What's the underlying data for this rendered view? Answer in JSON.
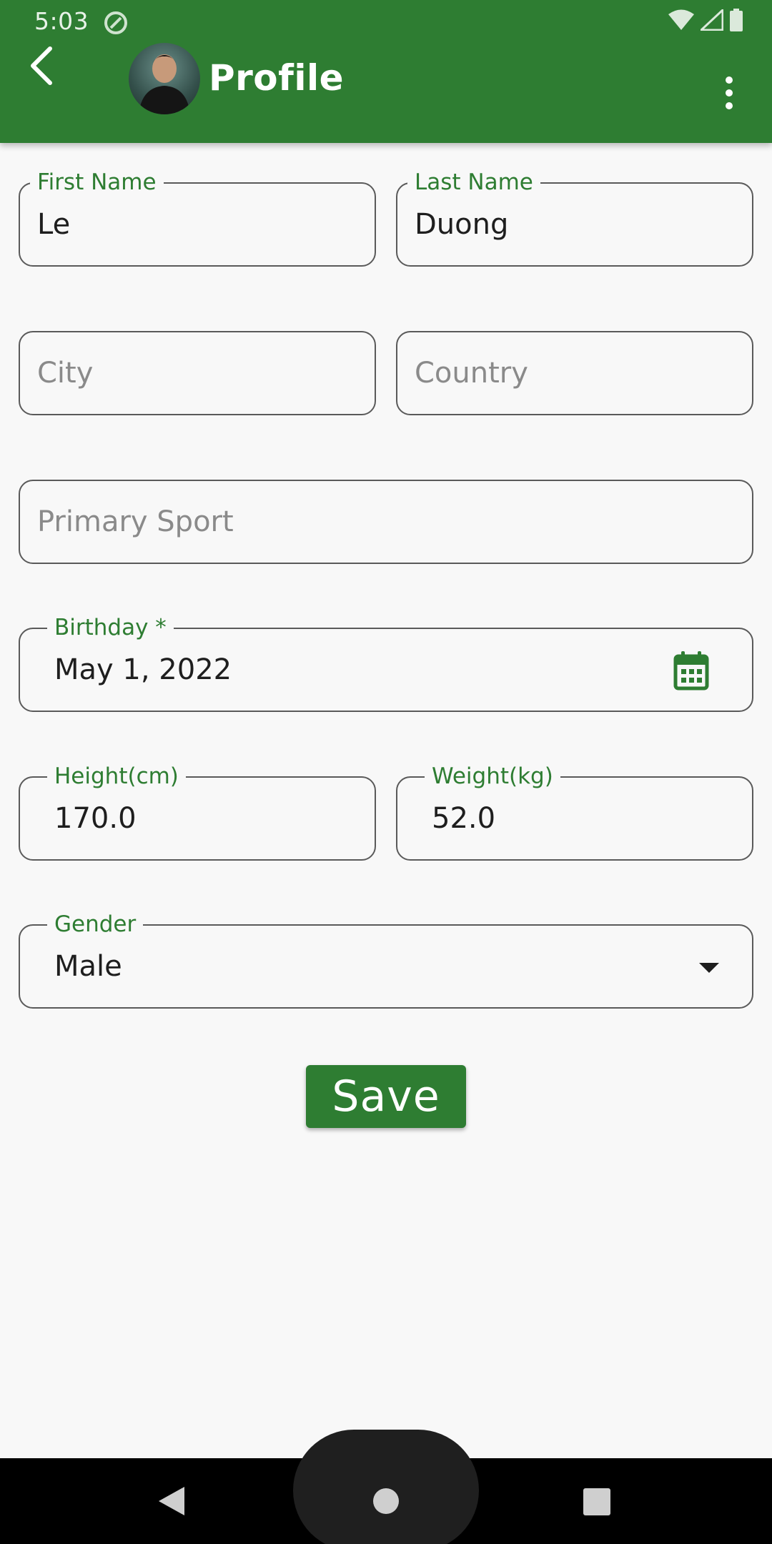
{
  "status_bar": {
    "time": "5:03"
  },
  "app_bar": {
    "title": "Profile"
  },
  "form": {
    "first_name": {
      "label": "First Name",
      "value": "Le"
    },
    "last_name": {
      "label": "Last Name",
      "value": "Duong"
    },
    "city": {
      "placeholder": "City"
    },
    "country": {
      "placeholder": "Country"
    },
    "primary_sport": {
      "placeholder": "Primary Sport"
    },
    "birthday": {
      "label": "Birthday *",
      "value": "May 1, 2022"
    },
    "height": {
      "label": "Height(cm)",
      "value": "170.0"
    },
    "weight": {
      "label": "Weight(kg)",
      "value": "52.0"
    },
    "gender": {
      "label": "Gender",
      "value": "Male"
    },
    "save_label": "Save"
  },
  "colors": {
    "primary": "#2e7d32",
    "background": "#f8f8f8",
    "outline": "#5a5a5a"
  },
  "icons": [
    "back-arrow-icon",
    "overflow-menu-icon",
    "calendar-icon",
    "dropdown-arrow-icon",
    "wifi-icon",
    "signal-icon",
    "battery-icon",
    "sync-icon"
  ]
}
